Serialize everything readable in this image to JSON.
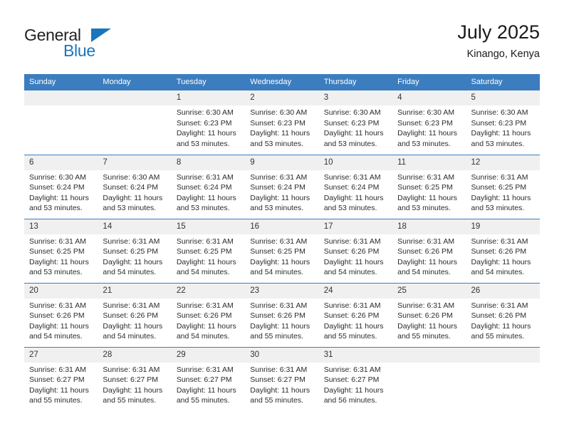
{
  "brand": {
    "name_part1": "General",
    "name_part2": "Blue",
    "triangle_color": "#1b75bb",
    "text_color": "#231f20"
  },
  "header": {
    "title": "July 2025",
    "subtitle": "Kinango, Kenya"
  },
  "theme": {
    "header_blue": "#3b7dbf",
    "daynum_band": "#f0f0f0",
    "text": "#2b2b2b"
  },
  "calendar": {
    "weekday_headers": [
      "Sunday",
      "Monday",
      "Tuesday",
      "Wednesday",
      "Thursday",
      "Friday",
      "Saturday"
    ],
    "labels": {
      "sunrise": "Sunrise:",
      "sunset": "Sunset:",
      "daylight": "Daylight:"
    },
    "weeks": [
      [
        {
          "day": "",
          "blank": true
        },
        {
          "day": "",
          "blank": true
        },
        {
          "day": "1",
          "sunrise": "Sunrise: 6:30 AM",
          "sunset": "Sunset: 6:23 PM",
          "daylight": "Daylight: 11 hours and 53 minutes."
        },
        {
          "day": "2",
          "sunrise": "Sunrise: 6:30 AM",
          "sunset": "Sunset: 6:23 PM",
          "daylight": "Daylight: 11 hours and 53 minutes."
        },
        {
          "day": "3",
          "sunrise": "Sunrise: 6:30 AM",
          "sunset": "Sunset: 6:23 PM",
          "daylight": "Daylight: 11 hours and 53 minutes."
        },
        {
          "day": "4",
          "sunrise": "Sunrise: 6:30 AM",
          "sunset": "Sunset: 6:23 PM",
          "daylight": "Daylight: 11 hours and 53 minutes."
        },
        {
          "day": "5",
          "sunrise": "Sunrise: 6:30 AM",
          "sunset": "Sunset: 6:23 PM",
          "daylight": "Daylight: 11 hours and 53 minutes."
        }
      ],
      [
        {
          "day": "6",
          "sunrise": "Sunrise: 6:30 AM",
          "sunset": "Sunset: 6:24 PM",
          "daylight": "Daylight: 11 hours and 53 minutes."
        },
        {
          "day": "7",
          "sunrise": "Sunrise: 6:30 AM",
          "sunset": "Sunset: 6:24 PM",
          "daylight": "Daylight: 11 hours and 53 minutes."
        },
        {
          "day": "8",
          "sunrise": "Sunrise: 6:31 AM",
          "sunset": "Sunset: 6:24 PM",
          "daylight": "Daylight: 11 hours and 53 minutes."
        },
        {
          "day": "9",
          "sunrise": "Sunrise: 6:31 AM",
          "sunset": "Sunset: 6:24 PM",
          "daylight": "Daylight: 11 hours and 53 minutes."
        },
        {
          "day": "10",
          "sunrise": "Sunrise: 6:31 AM",
          "sunset": "Sunset: 6:24 PM",
          "daylight": "Daylight: 11 hours and 53 minutes."
        },
        {
          "day": "11",
          "sunrise": "Sunrise: 6:31 AM",
          "sunset": "Sunset: 6:25 PM",
          "daylight": "Daylight: 11 hours and 53 minutes."
        },
        {
          "day": "12",
          "sunrise": "Sunrise: 6:31 AM",
          "sunset": "Sunset: 6:25 PM",
          "daylight": "Daylight: 11 hours and 53 minutes."
        }
      ],
      [
        {
          "day": "13",
          "sunrise": "Sunrise: 6:31 AM",
          "sunset": "Sunset: 6:25 PM",
          "daylight": "Daylight: 11 hours and 53 minutes."
        },
        {
          "day": "14",
          "sunrise": "Sunrise: 6:31 AM",
          "sunset": "Sunset: 6:25 PM",
          "daylight": "Daylight: 11 hours and 54 minutes."
        },
        {
          "day": "15",
          "sunrise": "Sunrise: 6:31 AM",
          "sunset": "Sunset: 6:25 PM",
          "daylight": "Daylight: 11 hours and 54 minutes."
        },
        {
          "day": "16",
          "sunrise": "Sunrise: 6:31 AM",
          "sunset": "Sunset: 6:25 PM",
          "daylight": "Daylight: 11 hours and 54 minutes."
        },
        {
          "day": "17",
          "sunrise": "Sunrise: 6:31 AM",
          "sunset": "Sunset: 6:26 PM",
          "daylight": "Daylight: 11 hours and 54 minutes."
        },
        {
          "day": "18",
          "sunrise": "Sunrise: 6:31 AM",
          "sunset": "Sunset: 6:26 PM",
          "daylight": "Daylight: 11 hours and 54 minutes."
        },
        {
          "day": "19",
          "sunrise": "Sunrise: 6:31 AM",
          "sunset": "Sunset: 6:26 PM",
          "daylight": "Daylight: 11 hours and 54 minutes."
        }
      ],
      [
        {
          "day": "20",
          "sunrise": "Sunrise: 6:31 AM",
          "sunset": "Sunset: 6:26 PM",
          "daylight": "Daylight: 11 hours and 54 minutes."
        },
        {
          "day": "21",
          "sunrise": "Sunrise: 6:31 AM",
          "sunset": "Sunset: 6:26 PM",
          "daylight": "Daylight: 11 hours and 54 minutes."
        },
        {
          "day": "22",
          "sunrise": "Sunrise: 6:31 AM",
          "sunset": "Sunset: 6:26 PM",
          "daylight": "Daylight: 11 hours and 54 minutes."
        },
        {
          "day": "23",
          "sunrise": "Sunrise: 6:31 AM",
          "sunset": "Sunset: 6:26 PM",
          "daylight": "Daylight: 11 hours and 55 minutes."
        },
        {
          "day": "24",
          "sunrise": "Sunrise: 6:31 AM",
          "sunset": "Sunset: 6:26 PM",
          "daylight": "Daylight: 11 hours and 55 minutes."
        },
        {
          "day": "25",
          "sunrise": "Sunrise: 6:31 AM",
          "sunset": "Sunset: 6:26 PM",
          "daylight": "Daylight: 11 hours and 55 minutes."
        },
        {
          "day": "26",
          "sunrise": "Sunrise: 6:31 AM",
          "sunset": "Sunset: 6:26 PM",
          "daylight": "Daylight: 11 hours and 55 minutes."
        }
      ],
      [
        {
          "day": "27",
          "sunrise": "Sunrise: 6:31 AM",
          "sunset": "Sunset: 6:27 PM",
          "daylight": "Daylight: 11 hours and 55 minutes."
        },
        {
          "day": "28",
          "sunrise": "Sunrise: 6:31 AM",
          "sunset": "Sunset: 6:27 PM",
          "daylight": "Daylight: 11 hours and 55 minutes."
        },
        {
          "day": "29",
          "sunrise": "Sunrise: 6:31 AM",
          "sunset": "Sunset: 6:27 PM",
          "daylight": "Daylight: 11 hours and 55 minutes."
        },
        {
          "day": "30",
          "sunrise": "Sunrise: 6:31 AM",
          "sunset": "Sunset: 6:27 PM",
          "daylight": "Daylight: 11 hours and 55 minutes."
        },
        {
          "day": "31",
          "sunrise": "Sunrise: 6:31 AM",
          "sunset": "Sunset: 6:27 PM",
          "daylight": "Daylight: 11 hours and 56 minutes."
        },
        {
          "day": "",
          "blank": true
        },
        {
          "day": "",
          "blank": true
        }
      ]
    ]
  }
}
